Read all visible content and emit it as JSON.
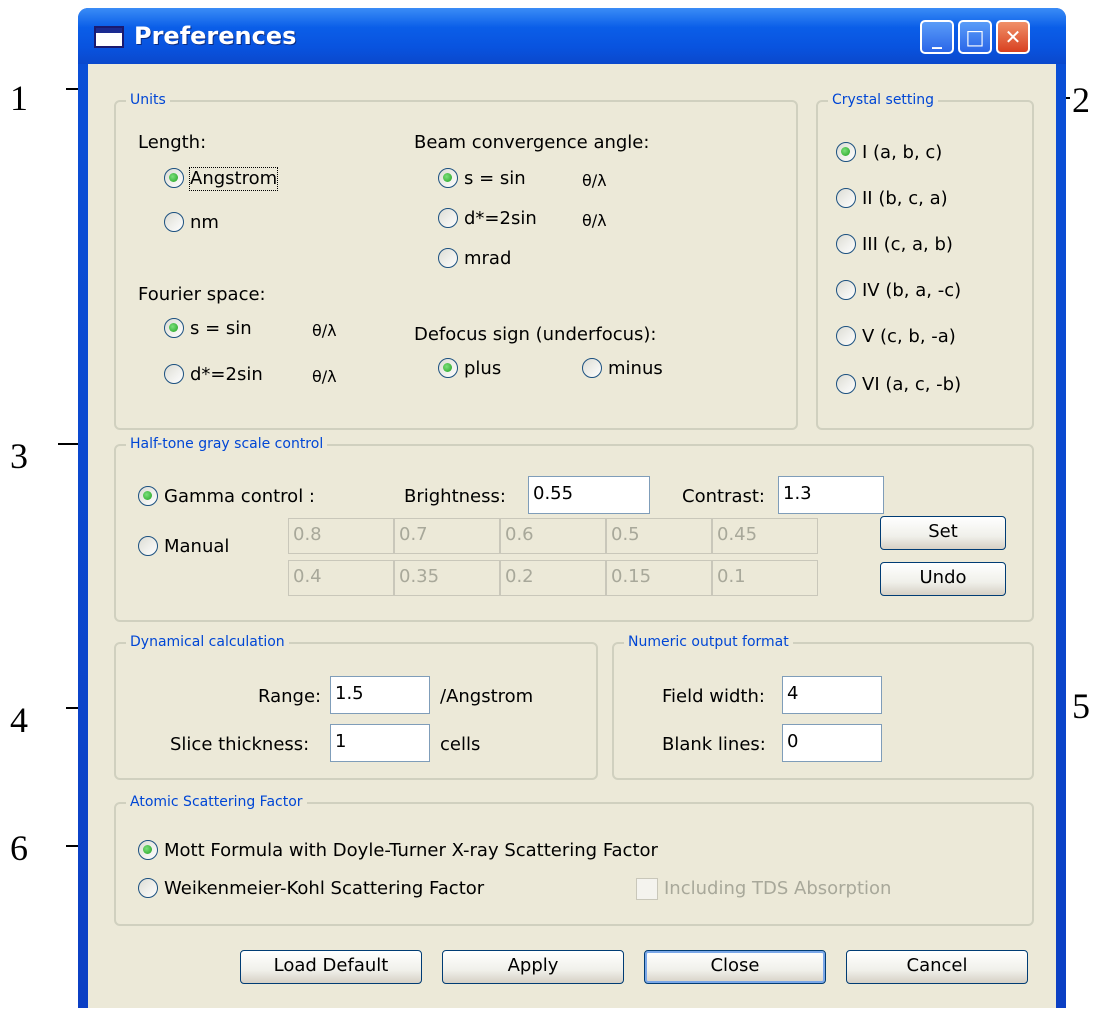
{
  "window": {
    "title": "Preferences",
    "controls": {
      "minimize": "_",
      "maximize": "□",
      "close": "✕"
    }
  },
  "callouts": [
    "1",
    "2",
    "3",
    "4",
    "5",
    "6"
  ],
  "units": {
    "group_label": "Units",
    "length": {
      "label": "Length:",
      "options": [
        "Angstrom",
        "nm"
      ],
      "selected": "Angstrom"
    },
    "fourier": {
      "label": "Fourier space:",
      "options": [
        {
          "text": "s = sin",
          "suffix": "θ/λ"
        },
        {
          "text": "d*=2sin",
          "suffix": "θ/λ"
        }
      ],
      "selected": 0
    },
    "beam": {
      "label": "Beam convergence angle:",
      "options": [
        {
          "text": "s = sin",
          "suffix": "θ/λ"
        },
        {
          "text": "d*=2sin",
          "suffix": "θ/λ"
        },
        {
          "text": "mrad",
          "suffix": ""
        }
      ],
      "selected": 0
    },
    "defocus": {
      "label": "Defocus sign (underfocus):",
      "options": [
        "plus",
        "minus"
      ],
      "selected": "plus"
    }
  },
  "crystal": {
    "group_label": "Crystal setting",
    "options": [
      "I (a, b, c)",
      "II (b, c, a)",
      "III (c, a, b)",
      "IV (b, a, -c)",
      "V (c, b, -a)",
      "VI (a, c, -b)"
    ],
    "selected": 0
  },
  "halftone": {
    "group_label": "Half-tone gray scale control",
    "gamma_label": "Gamma control :",
    "manual_label": "Manual",
    "selected": "gamma",
    "brightness_label": "Brightness:",
    "brightness_value": "0.55",
    "contrast_label": "Contrast:",
    "contrast_value": "1.3",
    "manual_values": [
      [
        "0.8",
        "0.7",
        "0.6",
        "0.5",
        "0.45"
      ],
      [
        "0.4",
        "0.35",
        "0.2",
        "0.15",
        "0.1"
      ]
    ],
    "set_label": "Set",
    "undo_label": "Undo"
  },
  "dynamical": {
    "group_label": "Dynamical calculation",
    "range_label": "Range:",
    "range_value": "1.5",
    "range_unit": "/Angstrom",
    "slice_label": "Slice thickness:",
    "slice_value": "1",
    "slice_unit": "cells"
  },
  "numeric": {
    "group_label": "Numeric output format",
    "field_width_label": "Field width:",
    "field_width_value": "4",
    "blank_lines_label": "Blank lines:",
    "blank_lines_value": "0"
  },
  "scattering": {
    "group_label": "Atomic Scattering Factor",
    "options": [
      "Mott Formula with Doyle-Turner X-ray Scattering Factor",
      "Weikenmeier-Kohl Scattering Factor"
    ],
    "selected": 0,
    "tds_label": "Including TDS Absorption"
  },
  "footer": {
    "load_default": "Load Default",
    "apply": "Apply",
    "close": "Close",
    "cancel": "Cancel"
  }
}
